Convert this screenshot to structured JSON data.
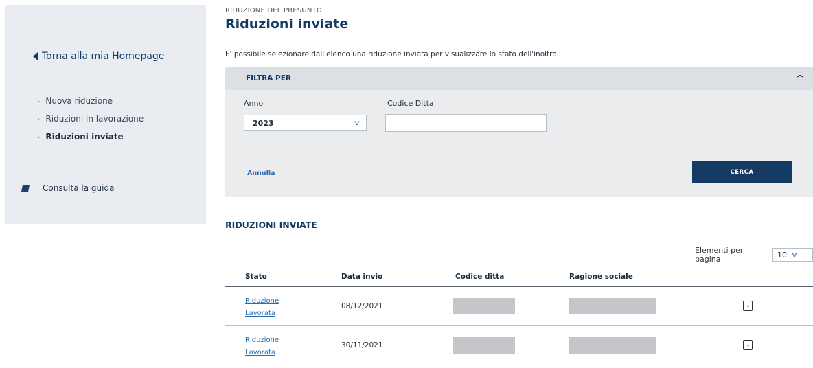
{
  "sidebar": {
    "back_label": "Torna alla mia Homepage",
    "items": [
      {
        "label": "Nuova riduzione",
        "active": false
      },
      {
        "label": "Riduzioni in lavorazione",
        "active": false
      },
      {
        "label": "Riduzioni inviate",
        "active": true
      }
    ],
    "guide_label": "Consulta la guida"
  },
  "header": {
    "eyebrow": "RIDUZIONE DEL PRESUNTO",
    "title": "Riduzioni inviate",
    "intro": "E' possibile selezionare dall'elenco una riduzione inviata per visualizzare lo stato dell'inoltro."
  },
  "filter": {
    "title": "FILTRA PER",
    "anno_label": "Anno",
    "anno_value": "2023",
    "codice_label": "Codice Ditta",
    "codice_value": "",
    "annulla_label": "Annulla",
    "cerca_label": "CERCA"
  },
  "results": {
    "title": "RIDUZIONI INVIATE",
    "per_page_label": "Elementi per pagina",
    "per_page_value": "10",
    "columns": [
      "Stato",
      "Data invio",
      "Codice ditta",
      "Ragione sociale"
    ],
    "rows": [
      {
        "stato": "Riduzione Lavorata",
        "data": "08/12/2021"
      },
      {
        "stato": "Riduzione Lavorata",
        "data": "30/11/2021"
      }
    ]
  },
  "icons": {
    "back": "caret-left-icon",
    "guide": "book-icon",
    "collapse": "chevron-up-icon",
    "dropdown": "chevron-down-icon",
    "pdf": "pdf-icon"
  },
  "colors": {
    "primary": "#123a63",
    "link": "#2b6bb5",
    "sidebar_bg": "#e9edf2",
    "filter_bg": "#eaecee"
  }
}
